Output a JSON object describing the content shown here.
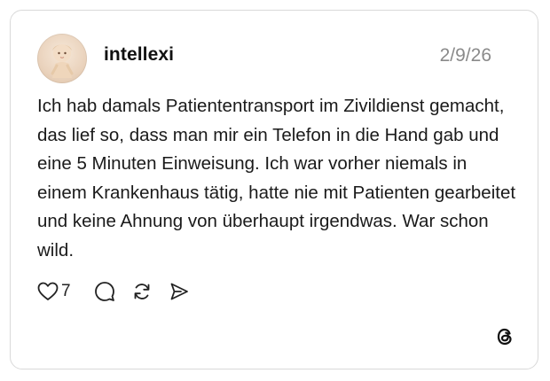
{
  "post": {
    "author": {
      "username": "intellexi",
      "avatar_icon": "doll-avatar"
    },
    "date": "2/9/26",
    "text": "Ich hab damals Patiententransport im Zivildienst gemacht, das lief so, dass man mir ein Telefon in die Hand gab und eine 5 Minuten Einweisung. Ich war vorher niemals in einem Krankenhaus tätig, hatte nie mit Patienten gearbeitet und keine Ahnung von überhaupt irgendwas. War schon wild.",
    "actions": {
      "like_icon": "heart-icon",
      "like_count": "7",
      "reply_icon": "comment-icon",
      "repost_icon": "repost-icon",
      "share_icon": "send-icon"
    },
    "brand_icon": "threads-logo"
  },
  "colors": {
    "border": "#d9d9d9",
    "text": "#1a1a1a",
    "muted": "#8a8a8a"
  }
}
